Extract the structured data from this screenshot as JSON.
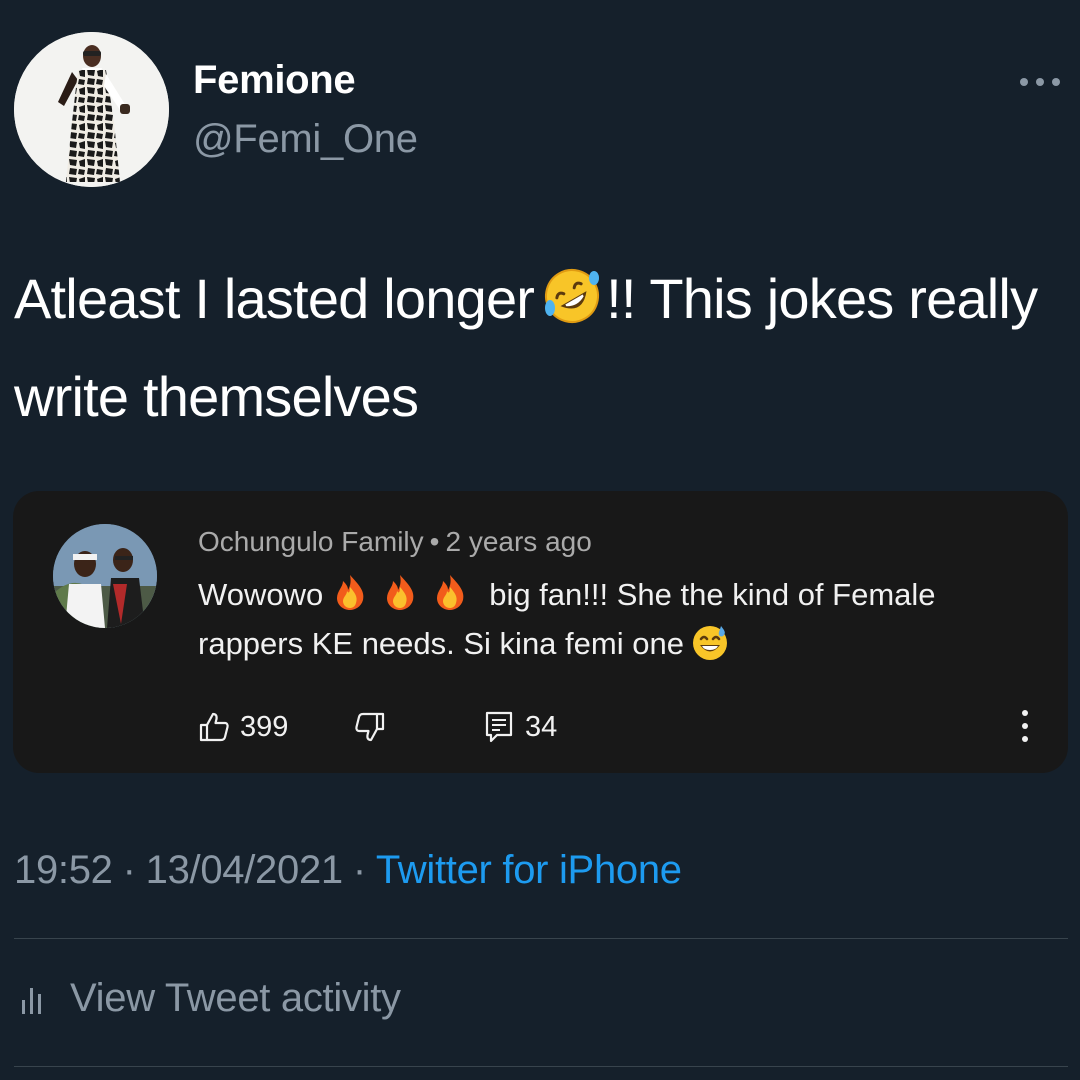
{
  "user": {
    "display_name": "Femione",
    "handle": "@Femi_One"
  },
  "tweet": {
    "text_before_emoji": "Atleast I lasted longer",
    "emoji": "rolling-on-floor-laughing",
    "text_after_emoji": "!! This jokes really write themselves"
  },
  "embedded_comment": {
    "author": "Ochungulo Family",
    "separator": "•",
    "age": "2 years ago",
    "text_start": "Wowowo",
    "fire_emoji_count": 3,
    "text_middle": "big fan!!! She the kind of Female rappers KE needs. Si kina femi one",
    "trailing_emoji": "grinning-face-with-sweat",
    "likes": "399",
    "replies": "34",
    "icons": [
      "thumbs-up-icon",
      "thumbs-down-icon",
      "reply-icon",
      "more-vertical-icon"
    ]
  },
  "meta": {
    "time": "19:52",
    "separator": "·",
    "date": "13/04/2021",
    "source": "Twitter for iPhone"
  },
  "activity": {
    "label": "View Tweet activity"
  },
  "colors": {
    "background": "#15202b",
    "card": "#181818",
    "secondary_text": "#8b98a5",
    "link": "#1d9bf0"
  }
}
